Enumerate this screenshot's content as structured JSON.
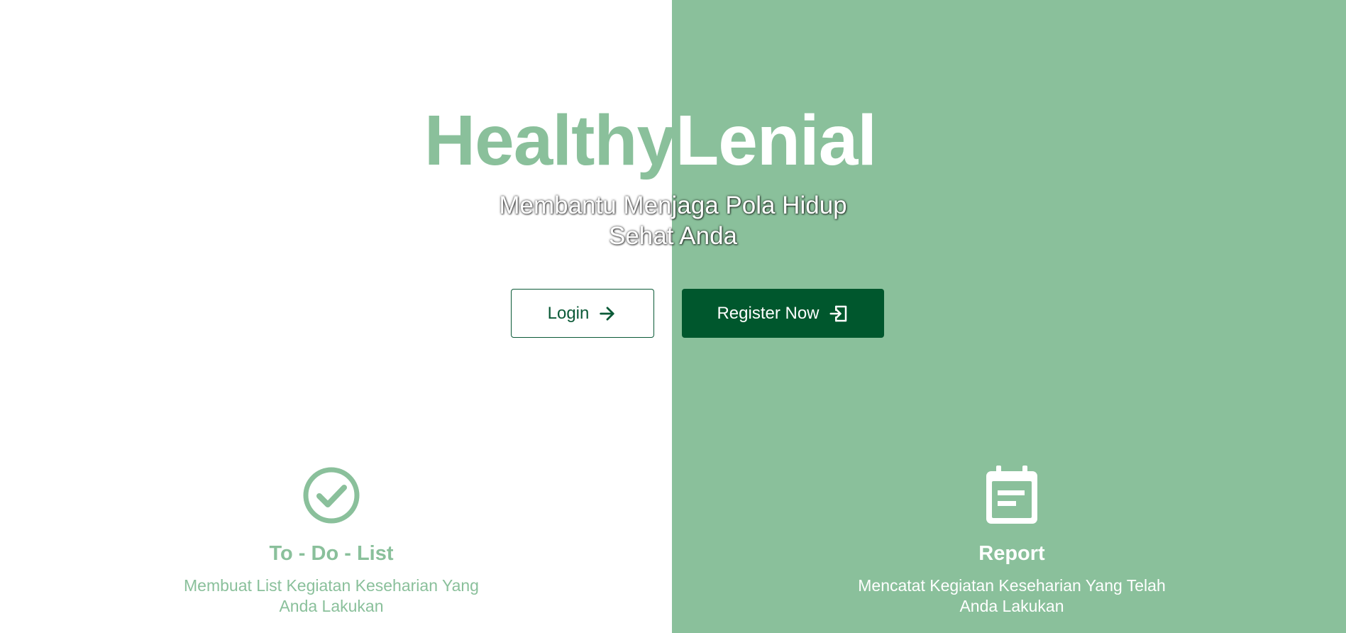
{
  "brand": {
    "part1": "Healthy",
    "part2": "Lenial"
  },
  "hero": {
    "tagline_line1": "Membantu Menjaga Pola Hidup",
    "tagline_line2": "Sehat Anda"
  },
  "actions": {
    "login_label": "Login",
    "register_label": "Register Now"
  },
  "features": [
    {
      "icon": "check-circle-icon",
      "title": "To - Do - List",
      "desc_line1": "Membuat List Kegiatan Keseharian Yang",
      "desc_line2": "Anda Lakukan"
    },
    {
      "icon": "calendar-note-icon",
      "title": "Report",
      "desc_line1": "Mencatat Kegiatan Keseharian Yang Telah",
      "desc_line2": "Anda Lakukan"
    }
  ],
  "colors": {
    "accent": "#8ac09b",
    "primary_dark": "#00572d",
    "white": "#ffffff"
  }
}
